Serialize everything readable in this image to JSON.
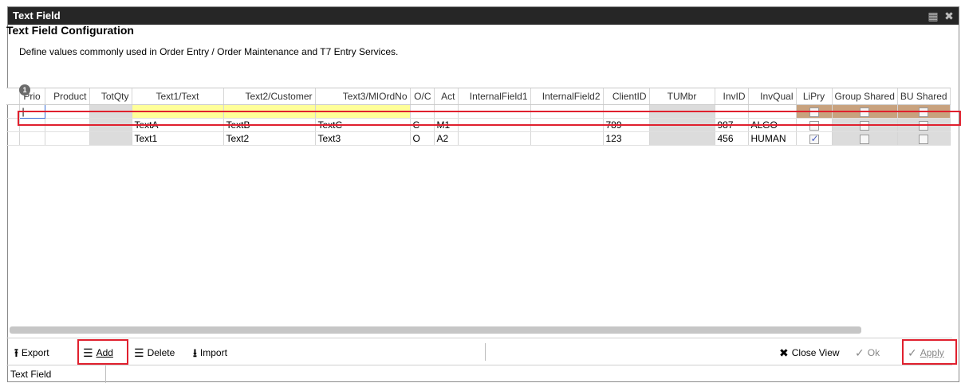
{
  "window": {
    "title": "Text Field"
  },
  "header": {
    "title": "Text Field Configuration",
    "description": "Define values commonly used in Order Entry / Order Maintenance and T7 Entry Services."
  },
  "grid": {
    "badge": "1",
    "columns": [
      "Prio",
      "Product",
      "TotQty",
      "Text1/Text",
      "Text2/Customer",
      "Text3/MIOrdNo",
      "O/C",
      "Act",
      "InternalField1",
      "InternalField2",
      "ClientID",
      "TUMbr",
      "InvID",
      "InvQual",
      "LiPry",
      "Group Shared",
      "BU Shared"
    ],
    "new_row_cursor": "|",
    "rows": [
      {
        "prio": "",
        "product": "",
        "totqty": "",
        "text1": "TextA",
        "text2": "TextB",
        "text3": "TextC",
        "oc": "C",
        "act": "M1",
        "if1": "",
        "if2": "",
        "clientid": "789",
        "tumbr": "",
        "invid": "987",
        "invqual": "ALGO",
        "lipry": false,
        "group_shared": false,
        "bu_shared": false
      },
      {
        "prio": "",
        "product": "",
        "totqty": "",
        "text1": "Text1",
        "text2": "Text2",
        "text3": "Text3",
        "oc": "O",
        "act": "A2",
        "if1": "",
        "if2": "",
        "clientid": "123",
        "tumbr": "",
        "invid": "456",
        "invqual": "HUMAN",
        "lipry": true,
        "group_shared": false,
        "bu_shared": false
      }
    ]
  },
  "toolbar": {
    "export": "Export",
    "add": "Add",
    "delete": "Delete",
    "import": "Import",
    "close_view": "Close View",
    "ok": "Ok",
    "apply": "Apply"
  },
  "status": {
    "text": "Text Field"
  },
  "colors": {
    "highlight_red": "#e0202e",
    "titlebar": "#262626",
    "new_row_yellow": "#ffff99",
    "new_row_tan": "#c8a27e"
  }
}
